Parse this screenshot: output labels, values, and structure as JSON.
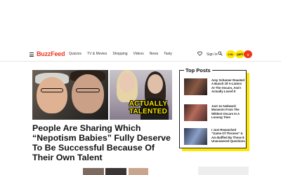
{
  "header": {
    "logo": "BuzzFeed",
    "nav": [
      "Quizzes",
      "TV & Movies",
      "Shopping",
      "Videos",
      "News",
      "Tasty"
    ],
    "signin": "Sign In",
    "badges": {
      "lol": "LOL",
      "omg": "OMG",
      "fire": "🔥"
    }
  },
  "hero": {
    "image_caption": "ACTUALLY TALENTED",
    "title": "People Are Sharing Which “Nepotism Babies” Fully Deserve To Be Successful Because Of Their Own Talent"
  },
  "top_posts": {
    "title": "Top Posts",
    "items": [
      {
        "text": "Amy Schumer Roasted A Bunch Of A-Listers At The Oscars, And I Actually Loved It"
      },
      {
        "text": "Just 14 Awkward Moments From The Wildest Oscars In A Looong Time"
      },
      {
        "text": "I Just Rewatched “Game Of Thrones” & Am Baffled By These 8 Unanswered Questions"
      }
    ]
  },
  "colors": {
    "brand": "#ee3322",
    "accent_yellow": "#ffe600"
  }
}
